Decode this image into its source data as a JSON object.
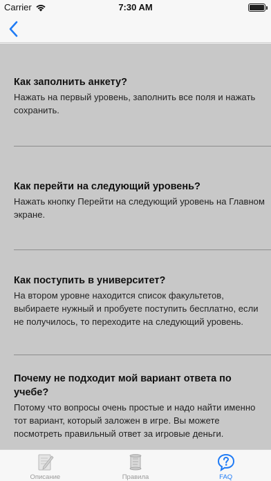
{
  "status_bar": {
    "carrier": "Carrier",
    "time": "7:30 AM"
  },
  "nav": {
    "back_icon": "chevron-left-icon",
    "accent_color": "#1f7bf5"
  },
  "faq": [
    {
      "question": "Как заполнить анкету?",
      "answer": "Нажать на первый уровень, заполнить все поля и нажать сохранить."
    },
    {
      "question": "Как перейти на следующий уровень?",
      "answer": "Нажать кнопку Перейти на следующий уровень на Главном экране."
    },
    {
      "question": "Как поступить в университет?",
      "answer": "На втором уровне находится список факультетов, выбираете нужный и пробуете поступить бесплатно, если не получилось, то переходите на следующий уровень."
    },
    {
      "question": "Почему не подходит мой вариант ответа по учебе?",
      "answer": "Потому что вопросы очень простые и надо найти именно тот вариант, который заложен в игре. Вы можете посмотреть правильный ответ за игровые деньги."
    }
  ],
  "tabs": [
    {
      "label": "Описание",
      "icon": "pencil-paper-icon",
      "active": false
    },
    {
      "label": "Правила",
      "icon": "scroll-icon",
      "active": false
    },
    {
      "label": "FAQ",
      "icon": "question-bubble-icon",
      "active": true
    }
  ],
  "colors": {
    "content_bg": "#c8c8c8",
    "separator": "#8d8d8d",
    "active_tab": "#1f7bf5",
    "inactive_tab": "#9a9a9a"
  }
}
